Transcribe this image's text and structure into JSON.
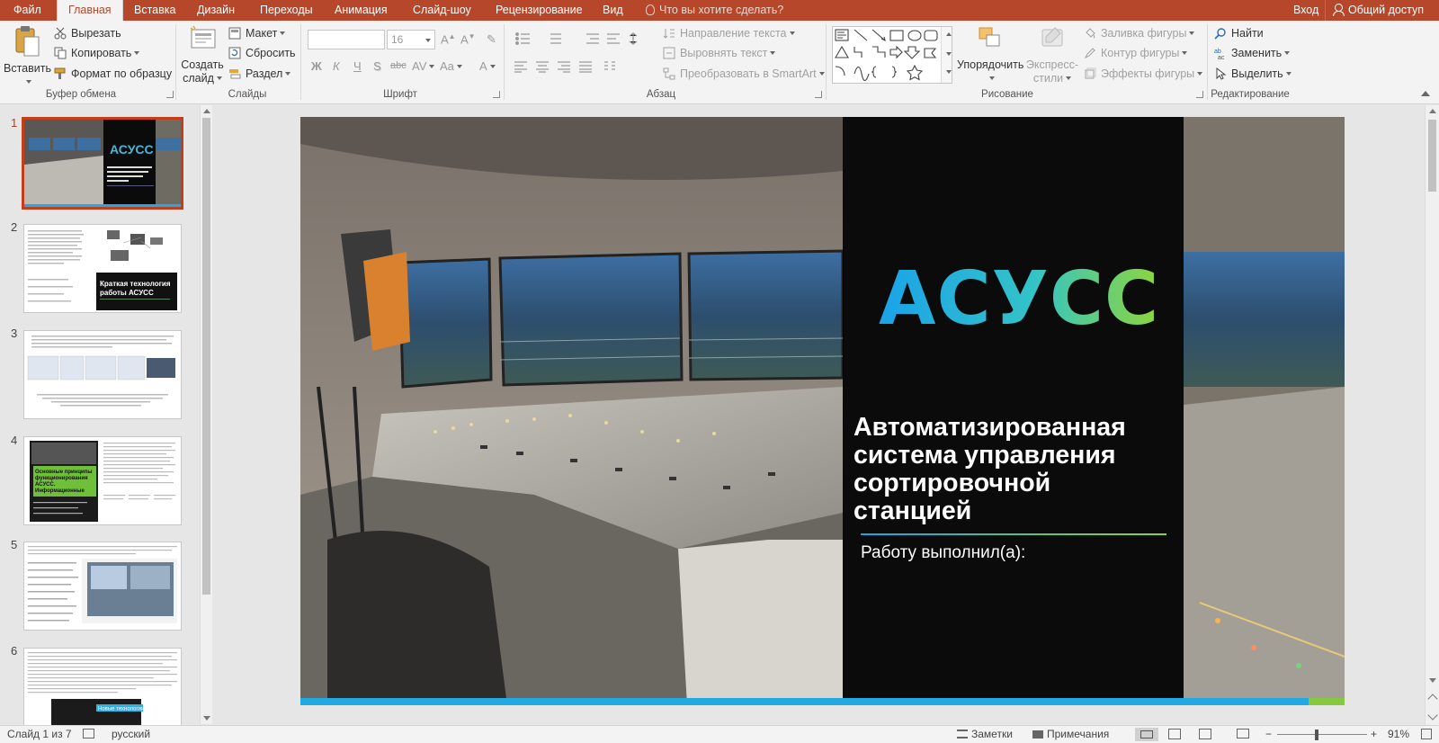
{
  "tabs": {
    "file": "Файл",
    "home": "Главная",
    "insert": "Вставка",
    "design": "Дизайн",
    "transitions": "Переходы",
    "animations": "Анимация",
    "slideshow": "Слайд-шоу",
    "review": "Рецензирование",
    "view": "Вид",
    "tell_me": "Что вы хотите сделать?",
    "sign_in": "Вход",
    "share": "Общий доступ"
  },
  "clipboard": {
    "paste": "Вставить",
    "cut": "Вырезать",
    "copy": "Копировать",
    "format_painter": "Формат по образцу",
    "label": "Буфер обмена"
  },
  "slides_group": {
    "new_slide_line1": "Создать",
    "new_slide_line2": "слайд",
    "layout": "Макет",
    "reset": "Сбросить",
    "section": "Раздел",
    "label": "Слайды"
  },
  "font": {
    "size": "16",
    "bold": "Ж",
    "italic": "К",
    "underline": "Ч",
    "strike": "S",
    "strike2": "abc",
    "spacing": "AV",
    "case": "Aa",
    "label": "Шрифт"
  },
  "paragraph": {
    "text_direction": "Направление текста",
    "align_text": "Выровнять текст",
    "smartart": "Преобразовать в SmartArt",
    "label": "Абзац"
  },
  "drawing": {
    "arrange": "Упорядочить",
    "quick_styles_line1": "Экспресс-",
    "quick_styles_line2": "стили",
    "shape_fill": "Заливка фигуры",
    "shape_outline": "Контур фигуры",
    "shape_effects": "Эффекты фигуры",
    "label": "Рисование"
  },
  "editing": {
    "find": "Найти",
    "replace": "Заменить",
    "select": "Выделить",
    "label": "Редактирование"
  },
  "thumbnails": [
    {
      "num": "1",
      "title": "АСУСС"
    },
    {
      "num": "2",
      "title": "Краткая технология работы АСУСС"
    },
    {
      "num": "3"
    },
    {
      "num": "4",
      "title": "Основные принципы функционирования АСУСС. Информационные сообщения"
    },
    {
      "num": "5"
    },
    {
      "num": "6",
      "title": "Новые технологии АСУСС"
    }
  ],
  "slide": {
    "title": "АСУСС",
    "subtitle_lines": [
      "Автоматизированная",
      "система управления",
      "сортировочной",
      "станцией"
    ],
    "author": "Работу выполнил(а):"
  },
  "status": {
    "slide_info": "Слайд 1 из 7",
    "language": "русский",
    "notes": "Заметки",
    "comments": "Примечания",
    "zoom": "91%"
  },
  "colors": {
    "accent": "#b7472a",
    "title_gradient_start": "#1aa3e8",
    "title_gradient_end": "#8ed63a"
  }
}
